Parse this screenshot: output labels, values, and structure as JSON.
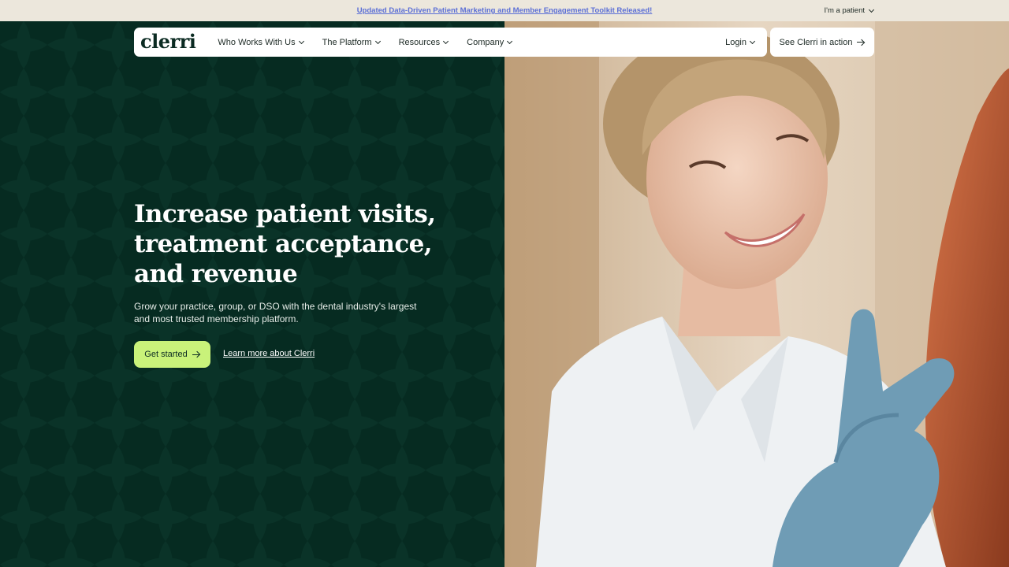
{
  "announcement": {
    "text": "Updated Data-Driven Patient Marketing and Member Engagement Toolkit Released!",
    "patient_toggle": "I'm a patient"
  },
  "nav": {
    "logo": "clerri",
    "items": [
      {
        "label": "Who Works With Us"
      },
      {
        "label": "The Platform"
      },
      {
        "label": "Resources"
      },
      {
        "label": "Company"
      }
    ],
    "login": "Login",
    "cta": "See Clerri in action"
  },
  "hero": {
    "headline_lines": [
      "Increase patient visits,",
      "treatment acceptance,",
      "and revenue"
    ],
    "subcopy": "Grow your practice, group, or DSO with the dental industry's largest and most trusted membership platform.",
    "primary_button": "Get started",
    "secondary_link": "Learn more about Clerri"
  },
  "colors": {
    "hero_bg": "#062b21",
    "announcement_bg": "#ece7dc",
    "accent": "#c9f27a",
    "link": "#5b6fd6"
  },
  "icons": [
    "chevron-down-icon",
    "arrow-right-icon"
  ]
}
